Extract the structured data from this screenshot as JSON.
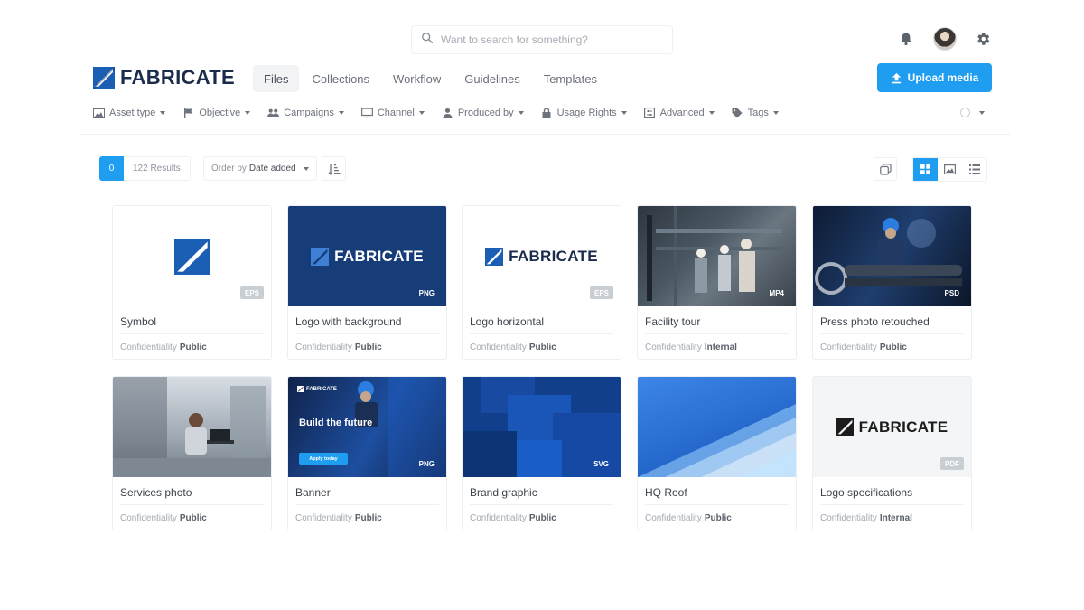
{
  "search": {
    "placeholder": "Want to search for something?"
  },
  "brand": {
    "name": "FABRICATE",
    "primary": "#1f9df0",
    "navy": "#1a2b4c"
  },
  "nav": {
    "tabs": [
      "Files",
      "Collections",
      "Workflow",
      "Guidelines",
      "Templates"
    ],
    "active": "Files"
  },
  "upload": {
    "label": "Upload media",
    "icon": "upload-icon"
  },
  "filters": [
    {
      "label": "Asset type",
      "icon": "image-icon"
    },
    {
      "label": "Objective",
      "icon": "flag-icon"
    },
    {
      "label": "Campaigns",
      "icon": "users-icon"
    },
    {
      "label": "Channel",
      "icon": "monitor-icon"
    },
    {
      "label": "Produced by",
      "icon": "user-icon"
    },
    {
      "label": "Usage Rights",
      "icon": "lock-icon"
    },
    {
      "label": "Advanced",
      "icon": "sliders-icon"
    },
    {
      "label": "Tags",
      "icon": "tag-icon"
    }
  ],
  "results": {
    "count": "0",
    "text": "122 Results"
  },
  "order": {
    "prefix": "Order by",
    "value": "Date added"
  },
  "meta_label": "Confidentiality",
  "cards": [
    {
      "title": "Symbol",
      "format": "EPS",
      "confidentiality": "Public"
    },
    {
      "title": "Logo with background",
      "format": "PNG",
      "confidentiality": "Public"
    },
    {
      "title": "Logo horizontal",
      "format": "EPS",
      "confidentiality": "Public"
    },
    {
      "title": "Facility tour",
      "format": "MP4",
      "confidentiality": "Internal"
    },
    {
      "title": "Press photo retouched",
      "format": "PSD",
      "confidentiality": "Public"
    },
    {
      "title": "Services photo",
      "format": "",
      "confidentiality": "Public"
    },
    {
      "title": "Banner",
      "format": "PNG",
      "confidentiality": "Public",
      "banner_brand": "FABRICATE",
      "banner_headline": "Build the future",
      "banner_button": "Apply today"
    },
    {
      "title": "Brand graphic",
      "format": "SVG",
      "confidentiality": "Public"
    },
    {
      "title": "HQ Roof",
      "format": "",
      "confidentiality": "Public"
    },
    {
      "title": "Logo specifications",
      "format": "PDF",
      "confidentiality": "Internal"
    }
  ]
}
